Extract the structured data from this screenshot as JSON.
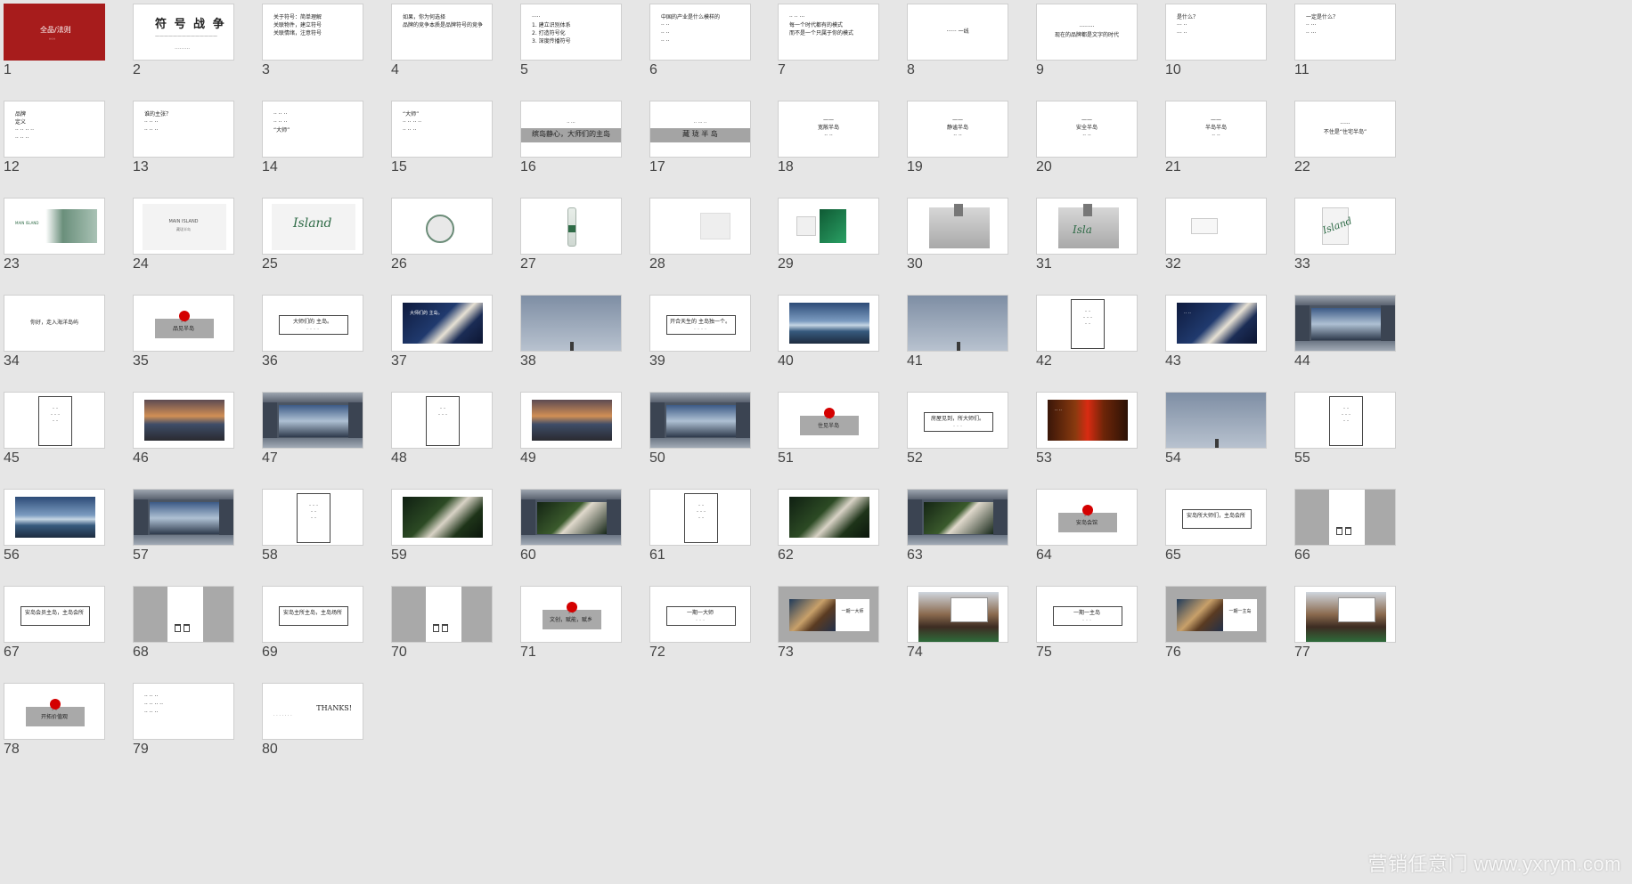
{
  "sorter": {
    "title": "slide-sorter",
    "watermark": "营销任意门 www.yxrym.com",
    "colors": {
      "background": "#e6e6e6",
      "accent_red": "#a71c1c",
      "dot_red": "#d40000",
      "gray": "#a9a9a9",
      "forest": "#2f6b47"
    }
  },
  "slides": [
    {
      "n": "1",
      "kind": "red",
      "texts": [
        "全品/法则",
        "。。。"
      ]
    },
    {
      "n": "2",
      "kind": "title",
      "texts": [
        "符 号 战 争",
        "——————————————",
        "·········"
      ]
    },
    {
      "n": "3",
      "kind": "lines",
      "texts": [
        "关于符号：简单理解",
        "关联物件，建立符号",
        "关联情绪，注意符号"
      ]
    },
    {
      "n": "4",
      "kind": "lines",
      "texts": [
        "如果，你为何选择",
        "品牌的竞争本质是品牌符号的竞争"
      ]
    },
    {
      "n": "5",
      "kind": "lines",
      "texts": [
        "·····",
        "1. 建立识别体系",
        "2. 打造符号化",
        "3. 深度传播符号"
      ]
    },
    {
      "n": "6",
      "kind": "lines",
      "texts": [
        "中国的产业是什么模样的",
        "·· ··",
        "·· ··",
        "·· ··"
      ]
    },
    {
      "n": "7",
      "kind": "lines",
      "texts": [
        "·· ·· ···",
        "每一个时代都有的模式",
        "而不是一个只属于你的模式"
      ]
    },
    {
      "n": "8",
      "kind": "center",
      "texts": [
        "······ 一线"
      ]
    },
    {
      "n": "9",
      "kind": "center",
      "texts": [
        "·········",
        "现在的品牌都是文字的时代"
      ]
    },
    {
      "n": "10",
      "kind": "lines",
      "texts": [
        "是什么？",
        "··· ··",
        "··· ··"
      ]
    },
    {
      "n": "11",
      "kind": "lines",
      "texts": [
        "一定是什么？",
        "·· ···",
        "·· ···"
      ]
    },
    {
      "n": "12",
      "kind": "lines",
      "texts": [
        "品牌",
        "定义",
        "·· ·· ·· ··",
        "·· ·· ··"
      ]
    },
    {
      "n": "13",
      "kind": "lines",
      "texts": [
        "谁的主张？",
        "·· ·· ··",
        "·· ·· ··"
      ]
    },
    {
      "n": "14",
      "kind": "lines",
      "texts": [
        "·· ·· ··",
        "·· ·· ··",
        "“大师”"
      ]
    },
    {
      "n": "15",
      "kind": "lines",
      "texts": [
        "“大师”",
        "·· ·· ·· ··",
        "·· ·· ··"
      ]
    },
    {
      "n": "16",
      "kind": "graybar",
      "texts": [
        "·· ···",
        "缤岛静心，大师们的主岛"
      ]
    },
    {
      "n": "17",
      "kind": "graybar",
      "texts": [
        "·· ··· ··",
        "藏 珑 半 岛"
      ]
    },
    {
      "n": "18",
      "kind": "center",
      "texts": [
        "——",
        "宽敞半岛",
        "·· ··"
      ]
    },
    {
      "n": "19",
      "kind": "center",
      "texts": [
        "——",
        "静谧半岛",
        "·· ··"
      ]
    },
    {
      "n": "20",
      "kind": "center",
      "texts": [
        "——",
        "安全半岛",
        "·· ··"
      ]
    },
    {
      "n": "21",
      "kind": "center",
      "texts": [
        "——",
        "半岛半岛",
        "·· ··"
      ]
    },
    {
      "n": "22",
      "kind": "center",
      "texts": [
        "······",
        "不住是“住宅半岛”"
      ]
    },
    {
      "n": "23",
      "kind": "mock-green",
      "texts": [
        "MAIN ISLAND"
      ]
    },
    {
      "n": "24",
      "kind": "mock-plain",
      "texts": [
        "MAIN ISLAND",
        "藏珑半岛"
      ]
    },
    {
      "n": "25",
      "kind": "mock-script",
      "texts": [
        "Island"
      ]
    },
    {
      "n": "26",
      "kind": "mock-badge",
      "texts": []
    },
    {
      "n": "27",
      "kind": "mock-bottle",
      "texts": []
    },
    {
      "n": "28",
      "kind": "mock-cards",
      "texts": []
    },
    {
      "n": "29",
      "kind": "mock-emerald",
      "texts": []
    },
    {
      "n": "30",
      "kind": "mock-bag",
      "texts": []
    },
    {
      "n": "31",
      "kind": "mock-bag-script",
      "texts": [
        "Isla"
      ]
    },
    {
      "n": "32",
      "kind": "mock-card",
      "texts": []
    },
    {
      "n": "33",
      "kind": "mock-script-small",
      "texts": [
        "Island"
      ]
    },
    {
      "n": "34",
      "kind": "center",
      "texts": [
        "你好，走入海洋岛屿"
      ]
    },
    {
      "n": "35",
      "kind": "reddot",
      "texts": [
        "·· ··",
        "品见半岛"
      ]
    },
    {
      "n": "36",
      "kind": "outline",
      "texts": [
        "大师们的 主岛。",
        "·· ·· ·· ··"
      ]
    },
    {
      "n": "37",
      "kind": "photo-person",
      "texts": [
        "大师们的 主岛。"
      ]
    },
    {
      "n": "38",
      "kind": "billboard",
      "texts": []
    },
    {
      "n": "39",
      "kind": "outline",
      "texts": [
        "开合天生的 主岛独一个。",
        "·· ·· ·· ··"
      ]
    },
    {
      "n": "40",
      "kind": "photo-sea",
      "texts": []
    },
    {
      "n": "41",
      "kind": "billboard",
      "texts": []
    },
    {
      "n": "42",
      "kind": "portrait",
      "texts": [
        "·· ··",
        "·· ·· ··",
        "·· ··"
      ]
    },
    {
      "n": "43",
      "kind": "photo-person",
      "texts": [
        "·· ··"
      ]
    },
    {
      "n": "44",
      "kind": "hall",
      "texts": []
    },
    {
      "n": "45",
      "kind": "portrait",
      "texts": [
        "·· ··",
        "·· ·· ··",
        "·· ··"
      ]
    },
    {
      "n": "46",
      "kind": "photo-sunset",
      "texts": []
    },
    {
      "n": "47",
      "kind": "hall",
      "texts": []
    },
    {
      "n": "48",
      "kind": "portrait",
      "texts": [
        "·· ··",
        "·· ·· ··"
      ]
    },
    {
      "n": "49",
      "kind": "photo-sunset",
      "texts": []
    },
    {
      "n": "50",
      "kind": "hall",
      "texts": []
    },
    {
      "n": "51",
      "kind": "reddot",
      "texts": [
        "·· ··",
        "住见半岛"
      ]
    },
    {
      "n": "52",
      "kind": "outline",
      "texts": [
        "房屋见到，所大师们。",
        "·· ·· ··"
      ]
    },
    {
      "n": "53",
      "kind": "photo-red",
      "texts": [
        "·· ··"
      ]
    },
    {
      "n": "54",
      "kind": "billboard-red",
      "texts": []
    },
    {
      "n": "55",
      "kind": "portrait",
      "texts": [
        "·· ··",
        "·· ·· ··",
        "·· ··"
      ]
    },
    {
      "n": "56",
      "kind": "photo-sea",
      "texts": []
    },
    {
      "n": "57",
      "kind": "hall",
      "texts": []
    },
    {
      "n": "58",
      "kind": "portrait",
      "texts": [
        "·· ·· ··",
        "·· ··",
        "·· ··"
      ]
    },
    {
      "n": "59",
      "kind": "photo-forest",
      "texts": []
    },
    {
      "n": "60",
      "kind": "hall-forest",
      "texts": []
    },
    {
      "n": "61",
      "kind": "portrait",
      "texts": [
        "·· ··",
        "·· ·· ··",
        "·· ··"
      ]
    },
    {
      "n": "62",
      "kind": "photo-forest",
      "texts": []
    },
    {
      "n": "63",
      "kind": "hall-forest",
      "texts": []
    },
    {
      "n": "64",
      "kind": "reddot",
      "texts": [
        "·· ··",
        "安岛会馆"
      ]
    },
    {
      "n": "65",
      "kind": "outline",
      "texts": [
        "安岛所大师们，主岛会所"
      ]
    },
    {
      "n": "66",
      "kind": "graypanel",
      "texts": []
    },
    {
      "n": "67",
      "kind": "outline",
      "texts": [
        "安岛会员主岛，主岛会所"
      ]
    },
    {
      "n": "68",
      "kind": "graypanel",
      "texts": []
    },
    {
      "n": "69",
      "kind": "outline",
      "texts": [
        "安岛主所主岛，主岛场所"
      ]
    },
    {
      "n": "70",
      "kind": "graypanel",
      "texts": []
    },
    {
      "n": "71",
      "kind": "reddot",
      "texts": [
        "·· ··",
        "文创，赋能，赋乡"
      ]
    },
    {
      "n": "72",
      "kind": "outline",
      "texts": [
        "一期一大师",
        "·· ·· ··"
      ]
    },
    {
      "n": "73",
      "kind": "gray-photo",
      "texts": [
        "一期一大师"
      ]
    },
    {
      "n": "74",
      "kind": "building",
      "texts": []
    },
    {
      "n": "75",
      "kind": "outline",
      "texts": [
        "一期一主岛",
        "·· ·· ··"
      ]
    },
    {
      "n": "76",
      "kind": "gray-photo",
      "texts": [
        "一期一主岛"
      ]
    },
    {
      "n": "77",
      "kind": "building",
      "texts": []
    },
    {
      "n": "78",
      "kind": "reddot",
      "texts": [
        "·· ··",
        "开拓价值观"
      ]
    },
    {
      "n": "79",
      "kind": "lines",
      "texts": [
        "·· ·· ··",
        "·· ·· ·· ··",
        "·· ·· ··"
      ]
    },
    {
      "n": "80",
      "kind": "thanks",
      "texts": [
        "THANKS!",
        "· · · · · · ·"
      ]
    }
  ]
}
